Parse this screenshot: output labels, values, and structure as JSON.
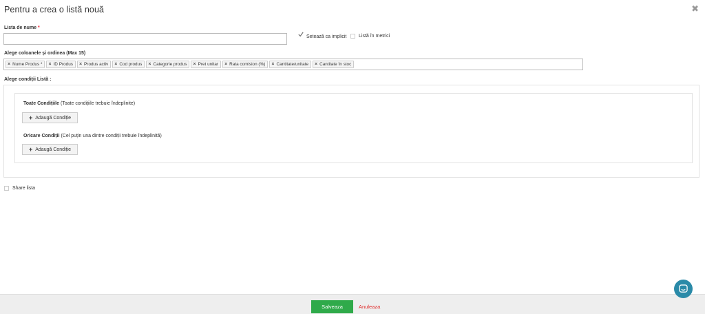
{
  "modal": {
    "title": "Pentru a crea o listă nouă",
    "close_icon": "close-icon"
  },
  "name_field": {
    "label": "Lista de nume",
    "required_mark": "*",
    "value": "",
    "placeholder": ""
  },
  "options": {
    "default_label": "Setează ca implicit",
    "default_checked": true,
    "metrics_label": "Listă în metrici",
    "metrics_checked": false
  },
  "columns": {
    "label": "Alege coloanele și ordinea (Max 15)",
    "tags": [
      "Nume Produs *",
      "ID Produs",
      "Produs activ",
      "Cod produs",
      "Categorie produs",
      "Pret unitar",
      "Rata comision (%)",
      "Cantitate/unitate",
      "Cantitate în stoc"
    ]
  },
  "conditions": {
    "label": "Alege condiții Listă :",
    "all": {
      "title": "Toate Condițiile",
      "hint": "(Toate condițiile trebuie îndeplinite)",
      "button": "Adaugă Condiție"
    },
    "any": {
      "title": "Oricare Condiții",
      "hint": "(Cel puțin una dintre condiții trebuie îndeplinită)",
      "button": "Adaugă Condiție"
    }
  },
  "share": {
    "label": "Share lista",
    "checked": false
  },
  "footer": {
    "save_label": "Salveaza",
    "cancel_label": "Anuleaza"
  },
  "colors": {
    "save": "#2faa4a",
    "cancel": "#e0302f",
    "chat": "#2a8aa8"
  }
}
